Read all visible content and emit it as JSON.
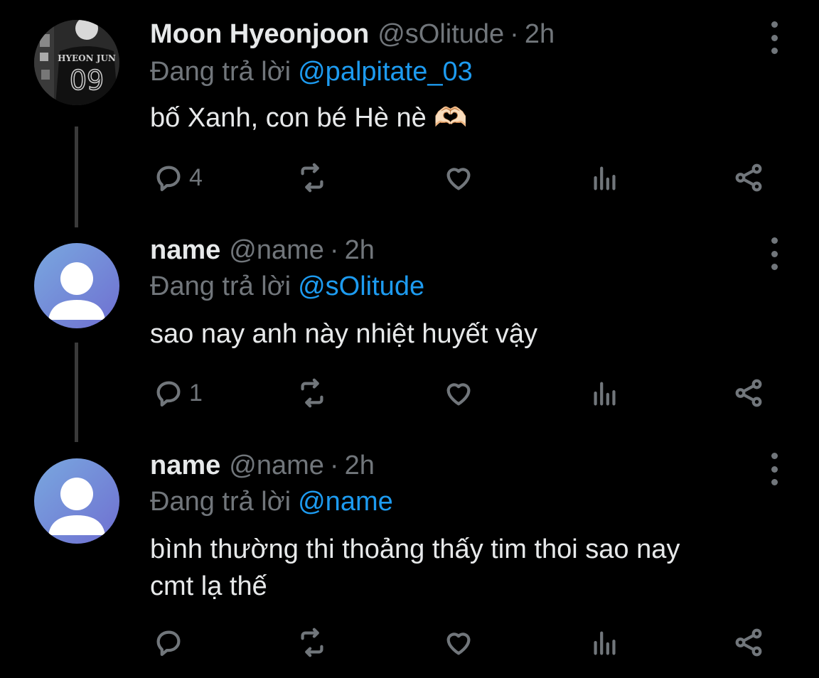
{
  "tweets": [
    {
      "name": "Moon Hyeonjoon",
      "handle": "@sOlitude",
      "separator": "·",
      "time": "2h",
      "reply_prefix": "Đang trả lời",
      "reply_to": "@palpitate_03",
      "text": "bố Xanh, con bé Hè nè 🫶🏻",
      "reply_count": "4",
      "avatar": "photo-avatar",
      "avatar_text": {
        "top": "HYEON JUN",
        "number": "09"
      }
    },
    {
      "name": "name",
      "handle": "@name",
      "separator": "·",
      "time": "2h",
      "reply_prefix": "Đang trả lời",
      "reply_to": "@sOlitude",
      "text": "sao nay anh này nhiệt huyết vậy",
      "reply_count": "1",
      "avatar": "default-avatar"
    },
    {
      "name": "name",
      "handle": "@name",
      "separator": "·",
      "time": "2h",
      "reply_prefix": "Đang trả lời",
      "reply_to": "@name",
      "text_line1": "bình thường thi thoảng thấy tim thoi sao nay",
      "text_line2": "cmt lạ thế",
      "reply_count": "",
      "avatar": "default-avatar"
    }
  ],
  "icons": [
    "reply-icon",
    "retweet-icon",
    "like-icon",
    "analytics-icon",
    "share-icon",
    "more-icon"
  ],
  "colors": {
    "background": "#000000",
    "text": "#e7e9ea",
    "muted": "#71767b",
    "mention": "#1d9bf0",
    "thread_line": "#3a3a3a"
  }
}
